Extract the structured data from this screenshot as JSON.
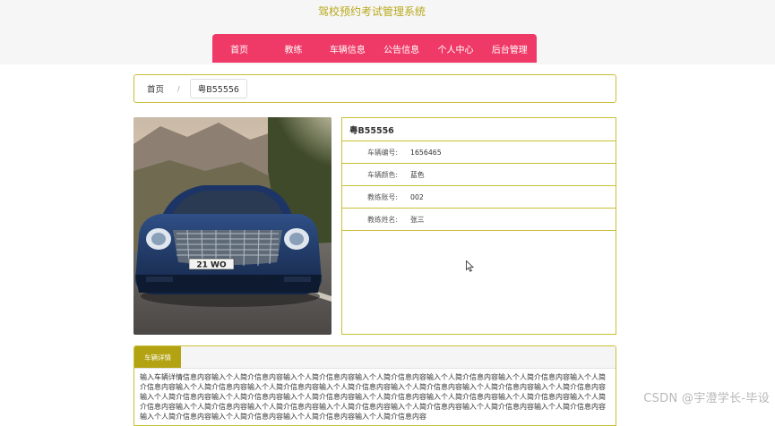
{
  "site": {
    "title": "驾校预约考试管理系统"
  },
  "nav": {
    "items": [
      {
        "label": "首页"
      },
      {
        "label": "教练"
      },
      {
        "label": "车辆信息"
      },
      {
        "label": "公告信息"
      },
      {
        "label": "个人中心"
      },
      {
        "label": "后台管理"
      }
    ]
  },
  "breadcrumb": {
    "home": "首页",
    "separator": "/",
    "current": "粤B55556"
  },
  "vehicle": {
    "plate": "粤B55556",
    "fields": [
      {
        "label": "车辆编号:",
        "value": "1656465"
      },
      {
        "label": "车辆颜色:",
        "value": "蓝色"
      },
      {
        "label": "教练账号:",
        "value": "002"
      },
      {
        "label": "教练姓名:",
        "value": "张三"
      }
    ]
  },
  "photo": {
    "plate_text": "21 WO"
  },
  "details": {
    "tab": "车辆详情",
    "text": "输入车辆详情信息内容输入个人简介信息内容输入个人简介信息内容输入个人简介信息内容输入个人简介信息内容输入个人简介信息内容输入个人简介信息内容输入个人简介信息内容输入个人简介信息内容输入个人简介信息内容输入个人简介信息内容输入个人简介信息内容输入个人简介信息内容输入个人简介信息内容输入个人简介信息内容输入个人简介信息内容输入个人简介信息内容输入个人简介信息内容输入个人简介信息内容输入个人简介信息内容输入个人简介信息内容输入个人简介信息内容输入个人简介信息内容输入个人简介信息内容输入个人简介信息内容输入个人简介信息内容输入个人简介信息内容输入个人简介信息内容输入个人简介信息内容输入个人简介信息内容"
  },
  "watermark": "CSDN @宇澄学长-毕设",
  "colors": {
    "nav": "#ef3a67",
    "accent": "#c8bf36",
    "tab": "#b3a312",
    "title": "#b9a91c"
  }
}
